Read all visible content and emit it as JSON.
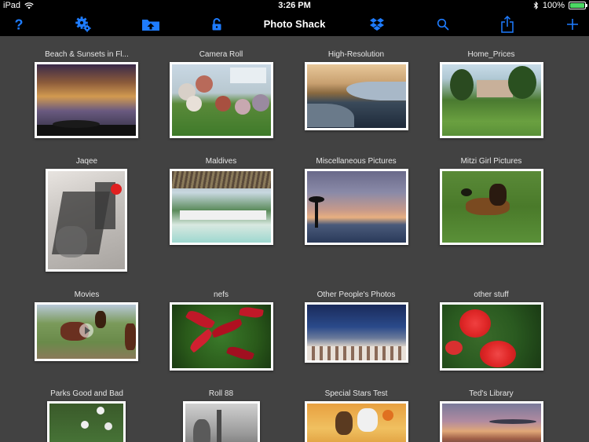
{
  "status_bar": {
    "device": "iPad",
    "time": "3:26 PM",
    "battery": "100%"
  },
  "nav_bar": {
    "title": "Photo Shack"
  },
  "colors": {
    "accent": "#1e7cff",
    "background": "#424242",
    "bar": "#000000"
  },
  "icons": {
    "help": "question-mark-icon",
    "settings": "gear-icon",
    "import": "folder-upload-icon",
    "lock": "unlocked-padlock-icon",
    "brand": "dropbox-icon",
    "search": "search-icon",
    "share": "share-icon",
    "add": "plus-icon"
  },
  "albums": [
    {
      "title": "Beach & Sunsets in Fl..."
    },
    {
      "title": "Camera Roll"
    },
    {
      "title": "High-Resolution"
    },
    {
      "title": "Home_Prices"
    },
    {
      "title": "Jaqee"
    },
    {
      "title": "Maldives"
    },
    {
      "title": "Miscellaneous Pictures"
    },
    {
      "title": "Mitzi Girl Pictures"
    },
    {
      "title": "Movies"
    },
    {
      "title": "nefs"
    },
    {
      "title": "Other People's Photos"
    },
    {
      "title": "other stuff"
    },
    {
      "title": "Parks Good and Bad"
    },
    {
      "title": "Roll 88"
    },
    {
      "title": "Special Stars Test"
    },
    {
      "title": "Ted's Library"
    }
  ]
}
